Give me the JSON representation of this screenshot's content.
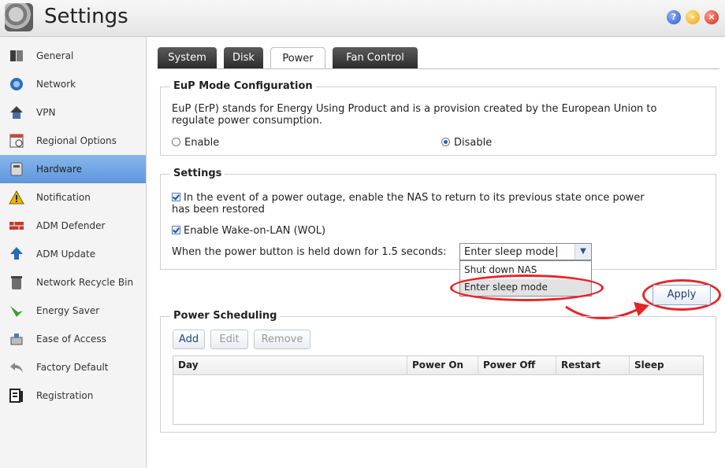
{
  "window": {
    "title": "Settings",
    "controls": [
      "help-icon",
      "minimize-icon",
      "close-icon"
    ],
    "control_glyphs": {
      "help": "?",
      "minimize": "–",
      "close": "×"
    }
  },
  "sidebar": {
    "items": [
      {
        "label": "General",
        "icon": "general-icon"
      },
      {
        "label": "Network",
        "icon": "network-icon"
      },
      {
        "label": "VPN",
        "icon": "vpn-icon"
      },
      {
        "label": "Regional Options",
        "icon": "regional-options-icon"
      },
      {
        "label": "Hardware",
        "icon": "hardware-icon",
        "active": true
      },
      {
        "label": "Notification",
        "icon": "notification-icon"
      },
      {
        "label": "ADM Defender",
        "icon": "adm-defender-icon"
      },
      {
        "label": "ADM Update",
        "icon": "adm-update-icon"
      },
      {
        "label": "Network Recycle Bin",
        "icon": "recycle-bin-icon"
      },
      {
        "label": "Energy Saver",
        "icon": "energy-saver-icon"
      },
      {
        "label": "Ease of Access",
        "icon": "ease-of-access-icon"
      },
      {
        "label": "Factory Default",
        "icon": "factory-default-icon"
      },
      {
        "label": "Registration",
        "icon": "registration-icon"
      }
    ]
  },
  "tabs": [
    {
      "label": "System"
    },
    {
      "label": "Disk"
    },
    {
      "label": "Power",
      "active": true
    },
    {
      "label": "Fan Control"
    }
  ],
  "eup": {
    "legend": "EuP Mode Configuration",
    "description": "EuP (ErP) stands for Energy Using Product and is a provision created by the European Union to regulate power consumption.",
    "description_line1": "EuP (ErP) stands for Energy Using Product and is a provision created by the European Union to",
    "description_line2": "regulate power consumption.",
    "enable_label": "Enable",
    "disable_label": "Disable",
    "selected": "Disable"
  },
  "settings": {
    "legend": "Settings",
    "power_restore_line1": "In the event of a power outage, enable the NAS to return to its previous state once power",
    "power_restore_line2": "has been restored",
    "power_restore_checked": true,
    "wol_label": "Enable Wake-on-LAN (WOL)",
    "wol_checked": true,
    "power_button_label": "When the power button is held down for 1.5 seconds:",
    "power_button_value": "Enter sleep mode",
    "power_button_options": [
      "Shut down NAS",
      "Enter sleep mode"
    ],
    "highlighted_option": "Enter sleep mode"
  },
  "apply_label": "Apply",
  "scheduling": {
    "legend": "Power Scheduling",
    "add_label": "Add",
    "edit_label": "Edit",
    "remove_label": "Remove",
    "columns": [
      "Day",
      "Power On",
      "Power Off",
      "Restart",
      "Sleep"
    ],
    "rows": []
  },
  "colors": {
    "active_sidebar": "#6fa3e4",
    "annotation": "#e4262a",
    "tab_dark": "#3a3a3a"
  }
}
